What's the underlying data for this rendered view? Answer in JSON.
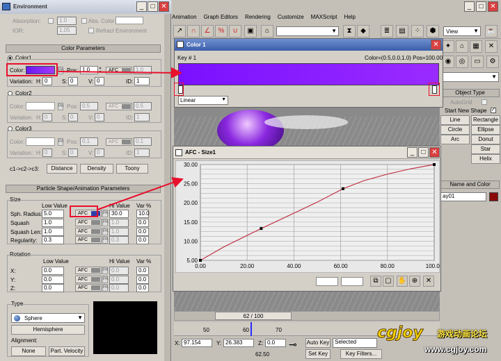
{
  "env": {
    "title": "Environment",
    "absorption_label": "Absorption:",
    "absorption_value": "1.0",
    "abs_color_label": "Abs. Color:",
    "ior_label": "IOR:",
    "ior_value": "1.05",
    "refract_label": "Refract Environment",
    "color_params_title": "Color Parameters",
    "color1": {
      "radio": "Color1",
      "color_label": "Color:",
      "pos_label": "Pos:",
      "pos": "1.0",
      "afc": "AFC",
      "afc_val": "1.0",
      "variation_label": "Variation:",
      "h_label": "H:",
      "h": "0",
      "s_label": "S:",
      "s": "0",
      "v_label": "V:",
      "v": "0",
      "id_label": "ID:",
      "id": "1"
    },
    "color2": {
      "radio": "Color2",
      "color_label": "Color:",
      "pos_label": "Pos:",
      "pos": "0.5",
      "afc": "AFC",
      "afc_val": "0.5",
      "variation_label": "Variation:",
      "h_label": "H:",
      "h": "0",
      "s_label": "S:",
      "s": "0",
      "v_label": "V:",
      "v": "0",
      "id_label": "ID:",
      "id": "1"
    },
    "color3": {
      "radio": "Color3",
      "color_label": "Color:",
      "pos_label": "Pos:",
      "pos": "0.1",
      "afc": "AFC",
      "afc_val": "0.1",
      "variation_label": "Variation:",
      "h_label": "H:",
      "h": "0",
      "s_label": "S:",
      "s": "0",
      "v_label": "V:",
      "v": "0",
      "id_label": "ID:",
      "id": "1"
    },
    "c_label": "c1->c2->c3:",
    "c_buttons": [
      "Distance",
      "Density",
      "Toony"
    ],
    "shape_title": "Particle Shape/Animation Parameters",
    "size_label": "Size",
    "low_value": "Low Value",
    "hi_value": "Hi Value",
    "var_pct": "Var %",
    "size_rows": [
      {
        "label": "Sph. Radius:",
        "low": "5.0",
        "hi": "30.0",
        "var": "10.0"
      },
      {
        "label": "Squash",
        "low": "1.0",
        "hi": "1.0",
        "var": "0.0"
      },
      {
        "label": "Squash Len:",
        "low": "1.0",
        "hi": "1.0",
        "var": "0.0"
      },
      {
        "label": "Regularity:",
        "low": "0.3",
        "hi": "0.3",
        "var": "0.0"
      }
    ],
    "rotation_label": "Rotation",
    "rot_low": "Low Value",
    "rot_hi": "Hi Value",
    "rot_var": "Var %",
    "rot_rows": [
      {
        "label": "X:",
        "low": "0.0",
        "hi": "0.0",
        "var": "0.0"
      },
      {
        "label": "Y:",
        "low": "0.0",
        "hi": "0.0",
        "var": "0.0"
      },
      {
        "label": "Z:",
        "low": "0.0",
        "hi": "0.0",
        "var": "0.0"
      }
    ],
    "afc": "AFC",
    "type_label": "Type",
    "type_value": "Sphere",
    "hemisphere": "Hemisphere",
    "alignment_label": "Alignment:",
    "align_buttons": [
      "None",
      "Part. Velocity"
    ]
  },
  "main": {
    "menu": [
      "Animation",
      "Graph Editors",
      "Rendering",
      "Customize",
      "MAXScript",
      "Help"
    ],
    "view_select": "View",
    "cmd_panel": {
      "object_type": "Object Type",
      "autogrid": "AutoGrid",
      "start_new_shape": "Start New Shape",
      "shape_buttons": [
        "Line",
        "Rectangle",
        "Circle",
        "Ellipse",
        "Arc",
        "Donut",
        "",
        "Star",
        "",
        "Helix"
      ],
      "name_color": "Name and Color",
      "name_value": "ay01"
    },
    "timeline": {
      "frame": "62 / 100",
      "ticks": [
        "50",
        "60",
        "70"
      ],
      "x_label": "X:",
      "x": "97.154",
      "y_label": "Y:",
      "y": "26.383",
      "z_label": "Z:",
      "z": "0.0",
      "time": "62.50",
      "auto_key": "Auto Key",
      "selected": "Selected",
      "set_key": "Set Key",
      "key_filters": "Key Filters..."
    }
  },
  "color_dialog": {
    "title": "Color 1",
    "key": "Key # 1",
    "info": "Color=(0.5,0.0,1.0)  Pos=100.00",
    "interp": "Linear",
    "gradient_start": "#7a10ff",
    "gradient_end": "#9a2bff"
  },
  "afc_dialog": {
    "title": "AFC - Size1"
  },
  "chart_data": {
    "type": "line",
    "title": "",
    "xlim": [
      0,
      100
    ],
    "ylim": [
      5,
      30
    ],
    "x_ticks": [
      "0.00",
      "20.00",
      "40.00",
      "60.00",
      "80.00",
      "100.00"
    ],
    "y_ticks": [
      "5.00",
      "10.00",
      "15.00",
      "20.00",
      "25.00",
      "30.00"
    ],
    "series": [
      {
        "color": "#c2384a",
        "points": [
          [
            0,
            5
          ],
          [
            10,
            8.5
          ],
          [
            20,
            11.5
          ],
          [
            26,
            13.3
          ],
          [
            40,
            17.3
          ],
          [
            50,
            20.2
          ],
          [
            61,
            23.7
          ],
          [
            70,
            25.8
          ],
          [
            80,
            27.5
          ],
          [
            90,
            28.9
          ],
          [
            100,
            30
          ]
        ],
        "keys": [
          [
            0,
            5
          ],
          [
            26,
            13.3
          ],
          [
            61,
            23.7
          ],
          [
            100,
            30
          ]
        ]
      }
    ]
  },
  "watermark": {
    "site": "www.cgjoy.com",
    "brand": "cgjoy",
    "tagline": "游戏动画论坛"
  }
}
